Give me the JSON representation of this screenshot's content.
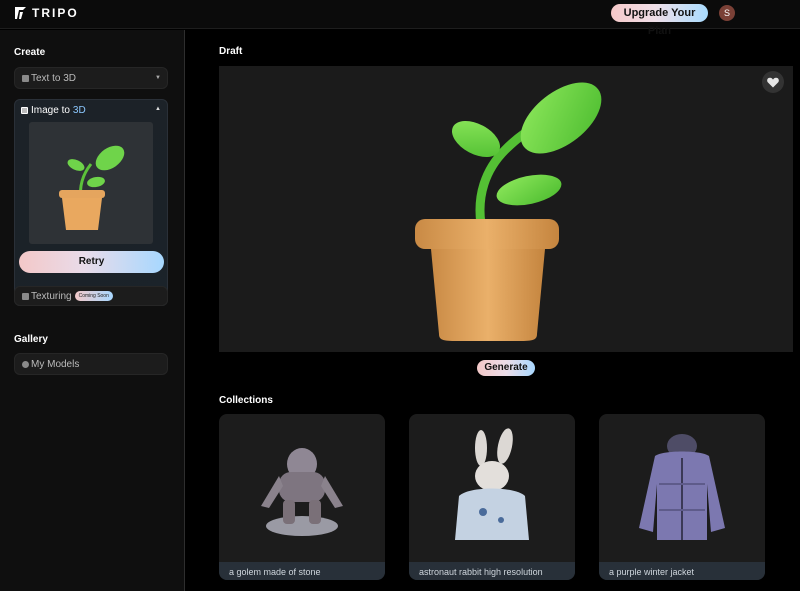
{
  "app": {
    "name": "TRIPO"
  },
  "header": {
    "upgrade_label": "Upgrade Your Plan",
    "avatar_initial": "S"
  },
  "sidebar": {
    "create_title": "Create",
    "text_to_3d": {
      "label": "Text to 3D",
      "icon": "text-icon"
    },
    "image_to_3d": {
      "label_prefix": "Image to",
      "label_highlight": "3D",
      "icon": "image-icon"
    },
    "retry_label": "Retry",
    "texturing": {
      "label": "Texturing",
      "badge": "Coming Soon"
    },
    "gallery_title": "Gallery",
    "my_models": {
      "label": "My Models",
      "icon": "cube-icon"
    }
  },
  "main": {
    "draft_title": "Draft",
    "generate_label": "Generate",
    "collections_title": "Collections",
    "collections": [
      {
        "caption": "a golem made of stone"
      },
      {
        "caption": "astronaut rabbit high resolution"
      },
      {
        "caption": "a purple winter jacket"
      }
    ]
  },
  "colors": {
    "accent_blue": "#8cc8ff",
    "gradient_pink": "#f3c8c8",
    "gradient_blue": "#a9d8ff"
  }
}
